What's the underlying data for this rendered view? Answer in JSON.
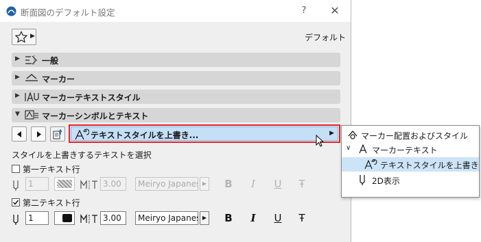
{
  "window": {
    "title": "断面図のデフォルト設定",
    "help_label": "?",
    "close_label": "✕"
  },
  "header": {
    "default_label": "デフォルト"
  },
  "sections": [
    {
      "label": "一般",
      "expanded": false,
      "icon": "general-settings-icon"
    },
    {
      "label": "マーカー",
      "expanded": false,
      "icon": "marker-icon"
    },
    {
      "label": "マーカーテキストスタイル",
      "expanded": false,
      "icon": "marker-text-style-icon"
    },
    {
      "label": "マーカーシンボルとテキスト",
      "expanded": true,
      "icon": "marker-symbol-text-icon"
    }
  ],
  "panel": {
    "dropdown_label": "テキストスタイルを上書き...",
    "prompt": "スタイルを上書きするテキストを選択",
    "first_line": {
      "label": "第一テキスト行",
      "checked": false,
      "pen_value": "1",
      "size_value": "3.00",
      "font": "Meiryo Japanese"
    },
    "second_line": {
      "label": "第二テキスト行",
      "checked": true,
      "pen_value": "1",
      "size_value": "3.00",
      "font": "Meiryo Japanese"
    },
    "style_buttons": {
      "bold": "B",
      "italic": "I",
      "underline": "U",
      "strike": "Ŧ"
    }
  },
  "popup_menu": {
    "items": [
      {
        "label": "マーカー配置およびスタイル",
        "icon": "marker-placement-icon",
        "selected": false
      },
      {
        "label": "マーカーテキスト",
        "icon": "text-icon",
        "selected": false,
        "expanded": true
      },
      {
        "label": "テキストスタイルを上書き",
        "icon": "text-style-override-icon",
        "selected": true
      },
      {
        "label": "2D表示",
        "icon": "pen-2d-icon",
        "selected": false
      }
    ]
  },
  "colors": {
    "highlight": "#c5dff7",
    "outline_red": "#e2222a",
    "section_bg": "#d6d6d6",
    "dialog_bg": "#efefef"
  }
}
